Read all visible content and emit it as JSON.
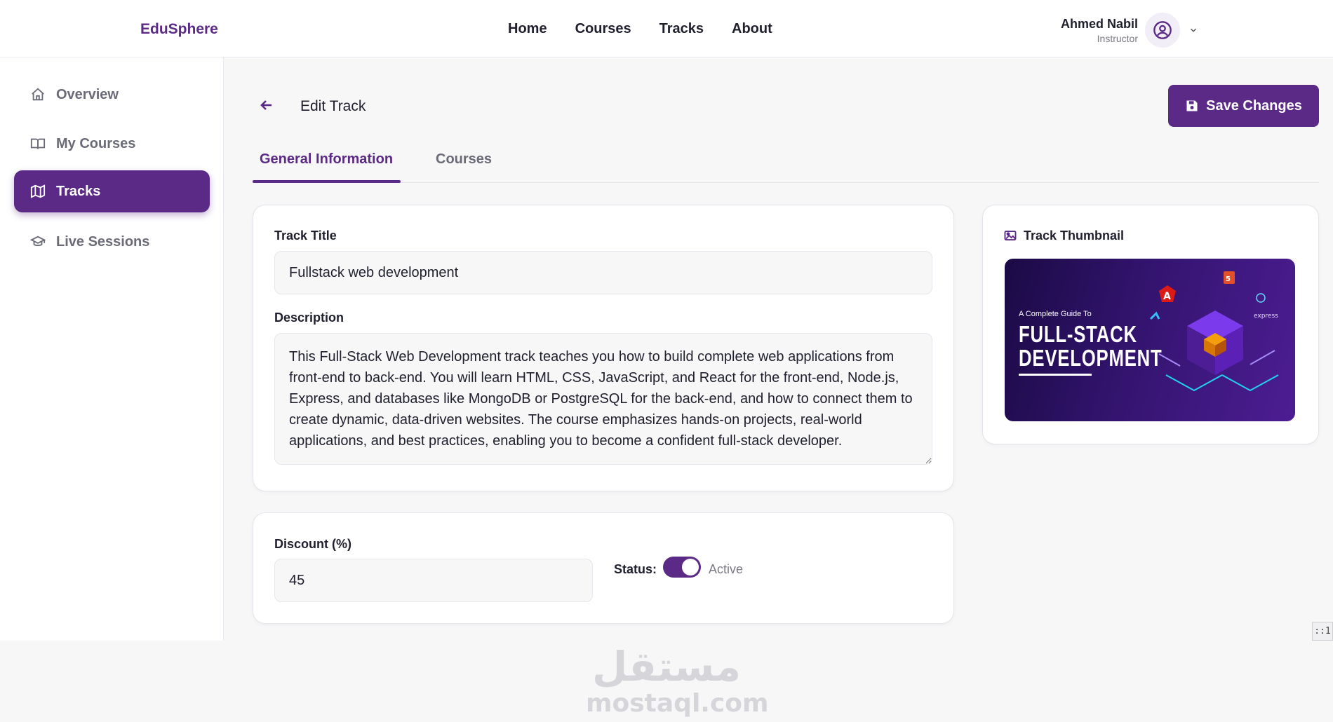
{
  "app": {
    "brand": "EduSphere"
  },
  "nav": [
    {
      "label": "Home"
    },
    {
      "label": "Courses"
    },
    {
      "label": "Tracks"
    },
    {
      "label": "About"
    }
  ],
  "user": {
    "name": "Ahmed Nabil",
    "role": "Instructor",
    "avatar_icon": "user-circle-icon"
  },
  "sidebar": {
    "items": [
      {
        "label": "Overview",
        "icon": "home-icon",
        "active": false
      },
      {
        "label": "My Courses",
        "icon": "book-open-icon",
        "active": false
      },
      {
        "label": "Tracks",
        "icon": "map-icon",
        "active": true
      },
      {
        "label": "Live Sessions",
        "icon": "graduation-cap-icon",
        "active": false
      }
    ]
  },
  "header": {
    "title": "Edit Track",
    "save_label": "Save Changes"
  },
  "tabs": [
    {
      "label": "General Information",
      "active": true
    },
    {
      "label": "Courses",
      "active": false
    }
  ],
  "form": {
    "title_label": "Track Title",
    "title_value": "Fullstack web development",
    "description_label": "Description",
    "description_value": "This Full-Stack Web Development track teaches you how to build complete web applications from front-end to back-end. You will learn HTML, CSS, JavaScript, and React for the front-end, Node.js, Express, and databases like MongoDB or PostgreSQL for the back-end, and how to connect them to create dynamic, data-driven websites. The course emphasizes hands-on projects, real-world applications, and best practices, enabling you to become a confident full-stack developer.",
    "discount_label": "Discount (%)",
    "discount_value": "45",
    "status_label": "Status:",
    "status_value": "Active",
    "status_on": true
  },
  "thumbnail": {
    "title": "Track Thumbnail",
    "image_subtitle": "A Complete Guide To",
    "image_line1": "FULL-STACK",
    "image_line2": "DEVELOPMENT",
    "image_badge": "express"
  },
  "watermark": {
    "arabic": "مستقل",
    "latin": "mostaql.com"
  },
  "corner_badge": "::1",
  "colors": {
    "accent": "#5b2a86",
    "background": "#f7f7f8",
    "text": "#1f1f2e",
    "muted": "#6b6b78"
  }
}
